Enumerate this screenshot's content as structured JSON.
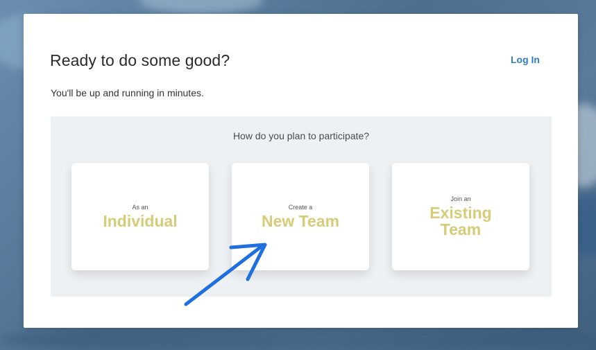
{
  "modal": {
    "title": "Ready to do some good?",
    "login_label": "Log In",
    "subtitle": "You'll be up and running in minutes."
  },
  "participation": {
    "question": "How do you plan to participate?",
    "options": [
      {
        "pre": "As an",
        "main": "Individual"
      },
      {
        "pre": "Create a",
        "main": "New Team"
      },
      {
        "pre": "Join an",
        "main_line1": "Existing",
        "main_line2": "Team"
      }
    ]
  },
  "colors": {
    "accent_link": "#2f7fc0",
    "option_text": "#d6cc78",
    "annotation_arrow": "#1e6fe0",
    "panel_bg": "#eef1f4"
  },
  "icons": {
    "annotation": "arrow-pointer-icon"
  }
}
